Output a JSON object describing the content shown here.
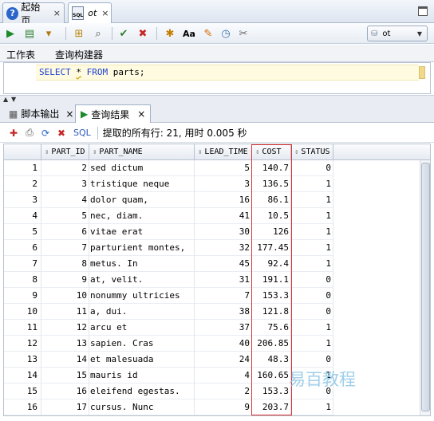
{
  "doc_tabs": [
    {
      "label": "起始页",
      "close": "×"
    },
    {
      "label": "ot",
      "close": "×"
    }
  ],
  "toolbar": {
    "connection": "ot"
  },
  "worksheet_tabs": [
    "工作表",
    "查询构建器"
  ],
  "editor": {
    "select_kw": "SELECT",
    "star": "*",
    "from_kw": "FROM",
    "table": "parts;"
  },
  "result_tabs": [
    {
      "label": "脚本输出",
      "close": "×"
    },
    {
      "label": "查询结果",
      "close": "×"
    }
  ],
  "results_toolbar": {
    "sql_label": "SQL",
    "status": "提取的所有行: 21, 用时 0.005 秒"
  },
  "grid": {
    "columns": [
      "PART_ID",
      "PART_NAME",
      "LEAD_TIME",
      "COST",
      "STATUS"
    ],
    "rows": [
      {
        "n": "1",
        "id": "2",
        "name": "sed dictum",
        "lead": "5",
        "cost": "140.7",
        "status": "0"
      },
      {
        "n": "2",
        "id": "3",
        "name": "tristique neque",
        "lead": "3",
        "cost": "136.5",
        "status": "1"
      },
      {
        "n": "3",
        "id": "4",
        "name": "dolor quam,",
        "lead": "16",
        "cost": "86.1",
        "status": "1"
      },
      {
        "n": "4",
        "id": "5",
        "name": "nec, diam.",
        "lead": "41",
        "cost": "10.5",
        "status": "1"
      },
      {
        "n": "5",
        "id": "6",
        "name": "vitae erat",
        "lead": "30",
        "cost": "126",
        "status": "1"
      },
      {
        "n": "6",
        "id": "7",
        "name": "parturient montes,",
        "lead": "32",
        "cost": "177.45",
        "status": "1"
      },
      {
        "n": "7",
        "id": "8",
        "name": "metus. In",
        "lead": "45",
        "cost": "92.4",
        "status": "1"
      },
      {
        "n": "8",
        "id": "9",
        "name": "at, velit.",
        "lead": "31",
        "cost": "191.1",
        "status": "0"
      },
      {
        "n": "9",
        "id": "10",
        "name": "nonummy ultricies",
        "lead": "7",
        "cost": "153.3",
        "status": "0"
      },
      {
        "n": "10",
        "id": "11",
        "name": "a, dui.",
        "lead": "38",
        "cost": "121.8",
        "status": "0"
      },
      {
        "n": "11",
        "id": "12",
        "name": "arcu et",
        "lead": "37",
        "cost": "75.6",
        "status": "1"
      },
      {
        "n": "12",
        "id": "13",
        "name": "sapien. Cras",
        "lead": "40",
        "cost": "206.85",
        "status": "1"
      },
      {
        "n": "13",
        "id": "14",
        "name": "et malesuada",
        "lead": "24",
        "cost": "48.3",
        "status": "0"
      },
      {
        "n": "14",
        "id": "15",
        "name": "mauris id",
        "lead": "4",
        "cost": "160.65",
        "status": "1"
      },
      {
        "n": "15",
        "id": "16",
        "name": "eleifend egestas.",
        "lead": "2",
        "cost": "153.3",
        "status": "0"
      },
      {
        "n": "16",
        "id": "17",
        "name": "cursus. Nunc",
        "lead": "9",
        "cost": "203.7",
        "status": "1"
      }
    ]
  },
  "watermark": "易百教程"
}
